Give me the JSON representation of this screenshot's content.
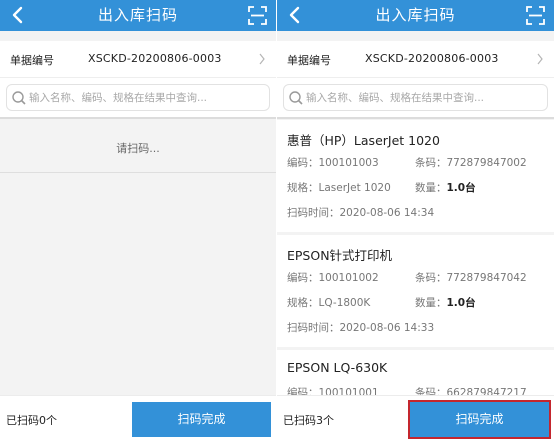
{
  "left": {
    "title": "出入库扫码",
    "doc_label": "单据编号",
    "doc_number": "XSCKD-20200806-0003",
    "search_placeholder": "输入名称、编码、规格在结果中查询...",
    "empty_text": "请扫码...",
    "scanned_count": "已扫码0个",
    "done_label": "扫码完成"
  },
  "right": {
    "title": "出入库扫码",
    "doc_label": "单据编号",
    "doc_number": "XSCKD-20200806-0003",
    "search_placeholder": "输入名称、编码、规格在结果中查询...",
    "scanned_count": "已扫码3个",
    "done_label": "扫码完成",
    "items": [
      {
        "name": "惠普（HP）LaserJet 1020",
        "code_label": "编码：",
        "code": "100101003",
        "barcode_label": "条码：",
        "barcode": "772879847002",
        "spec_label": "规格：",
        "spec": "LaserJet 1020",
        "qty_label": "数量：",
        "qty": "1.0台",
        "time_label": "扫码时间：",
        "time": "2020-08-06 14:34"
      },
      {
        "name": "EPSON针式打印机",
        "code_label": "编码：",
        "code": "100101002",
        "barcode_label": "条码：",
        "barcode": "772879847042",
        "spec_label": "规格：",
        "spec": "LQ-1800K",
        "qty_label": "数量：",
        "qty": "1.0台",
        "time_label": "扫码时间：",
        "time": "2020-08-06 14:33"
      },
      {
        "name": "EPSON LQ-630K",
        "code_label": "编码：",
        "code": "100101001",
        "barcode_label": "条码：",
        "barcode": "662879847217"
      }
    ]
  },
  "colors": {
    "header_blue": "#3391d8",
    "highlight_red": "#c4262e"
  },
  "icons": [
    "back-arrow-icon",
    "scan-icon",
    "search-icon",
    "chevron-right-icon"
  ]
}
